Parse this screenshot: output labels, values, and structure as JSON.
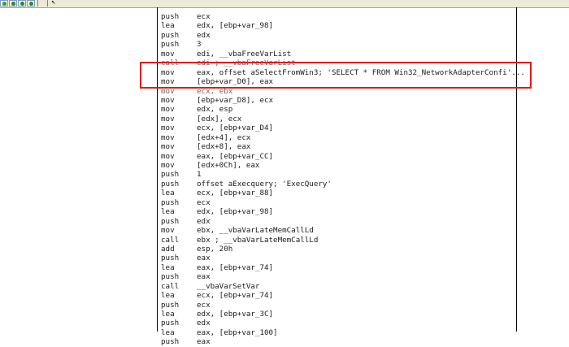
{
  "toolbar": {
    "buttons": [
      {
        "icon": "gear-icon",
        "color": "#3a9a3a"
      },
      {
        "icon": "step-into-icon",
        "color": "#2d8a2d"
      },
      {
        "icon": "step-over-icon",
        "color": "#2d8a2d"
      },
      {
        "icon": "step-out-icon",
        "color": "#2d8a2d"
      }
    ],
    "cursor_icon": "arrow-cursor-icon"
  },
  "highlight_color": "#e01b1b",
  "listing": [
    {
      "m": "push",
      "o": "ecx"
    },
    {
      "m": "lea",
      "o": "edx, [ebp+var_98]"
    },
    {
      "m": "push",
      "o": "edx"
    },
    {
      "m": "push",
      "o": "3"
    },
    {
      "m": "mov",
      "o": "edi, __vbaFreeVarList"
    },
    {
      "m": "call",
      "o": "edi ; __vbaFreeVarList"
    },
    {
      "m": "mov",
      "o": "eax, offset aSelectFromWin3; 'SELECT * FROM Win32_NetworkAdapterConfi'..."
    },
    {
      "m": "mov",
      "o": "[ebp+var_D0], eax"
    },
    {
      "m": "mov",
      "o": "ecx, ebx"
    },
    {
      "m": "mov",
      "o": "[ebp+var_D8], ecx"
    },
    {
      "m": "mov",
      "o": "edx, esp"
    },
    {
      "m": "mov",
      "o": "[edx], ecx"
    },
    {
      "m": "mov",
      "o": "ecx, [ebp+var_D4]"
    },
    {
      "m": "mov",
      "o": "[edx+4], ecx"
    },
    {
      "m": "mov",
      "o": "[edx+8], eax"
    },
    {
      "m": "mov",
      "o": "eax, [ebp+var_CC]"
    },
    {
      "m": "mov",
      "o": "[edx+0Ch], eax"
    },
    {
      "m": "push",
      "o": "1"
    },
    {
      "m": "push",
      "o": "offset aExecquery; 'ExecQuery'"
    },
    {
      "m": "lea",
      "o": "ecx, [ebp+var_88]"
    },
    {
      "m": "push",
      "o": "ecx"
    },
    {
      "m": "lea",
      "o": "edx, [ebp+var_98]"
    },
    {
      "m": "push",
      "o": "edx"
    },
    {
      "m": "mov",
      "o": "ebx, __vbaVarLateMemCallLd"
    },
    {
      "m": "call",
      "o": "ebx ; __vbaVarLateMemCallLd"
    },
    {
      "m": "add",
      "o": "esp, 20h"
    },
    {
      "m": "push",
      "o": "eax"
    },
    {
      "m": "lea",
      "o": "eax, [ebp+var_74]"
    },
    {
      "m": "push",
      "o": "eax"
    },
    {
      "m": "call",
      "o": "__vbaVarSetVar"
    },
    {
      "m": "lea",
      "o": "ecx, [ebp+var_74]"
    },
    {
      "m": "push",
      "o": "ecx"
    },
    {
      "m": "lea",
      "o": "edx, [ebp+var_3C]"
    },
    {
      "m": "push",
      "o": "edx"
    },
    {
      "m": "lea",
      "o": "eax, [ebp+var_100]"
    },
    {
      "m": "push",
      "o": "eax"
    }
  ]
}
